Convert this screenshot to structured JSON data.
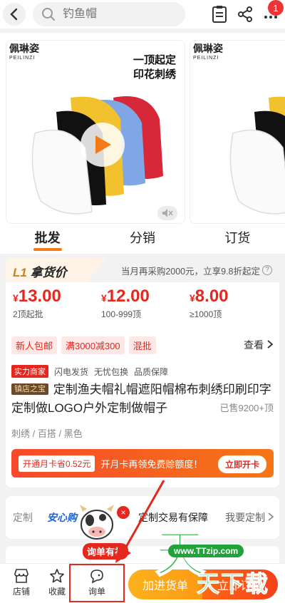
{
  "search": {
    "placeholder": "钓鱼帽"
  },
  "header": {
    "notification_count": "1"
  },
  "carousel": {
    "brand_cn": "佩琳姿",
    "brand_en": "PEILINZI",
    "promo_line1": "一顶起定",
    "promo_line2": "印花刺绣",
    "second_brand_cn": "佩琳姿",
    "second_brand_en": "PEILINZI"
  },
  "tabs": [
    {
      "label": "批发",
      "active": true
    },
    {
      "label": "分销",
      "active": false
    },
    {
      "label": "订货",
      "active": false
    }
  ],
  "tier": {
    "level": "L1",
    "level_label": "拿货价",
    "promo": "当月再采购2000元，立享9.8折起定",
    "help": "?"
  },
  "prices": [
    {
      "currency": "¥",
      "amount": "13.00",
      "range": "2顶起批"
    },
    {
      "currency": "¥",
      "amount": "12.00",
      "range": "100-999顶"
    },
    {
      "currency": "¥",
      "amount": "8.00",
      "range": "≥1000顶"
    }
  ],
  "tags": [
    "新人包邮",
    "满3000减300",
    "混批"
  ],
  "view_more": "查看",
  "service_badges": {
    "merchant": "实力商家",
    "items": [
      "闪电发货",
      "无忧包换",
      "品质保障"
    ]
  },
  "product": {
    "store_badge": "镇店之宝",
    "title": "定制渔夫帽礼帽遮阳帽棉布刺绣印刷印字定制做LOGO户外定制做帽子",
    "sold": "已售9200+顶",
    "attrs": "刺绣 / 百搭 / 黑色"
  },
  "member": {
    "chip": "开通月卡省0.52元",
    "text": "开月卡再领免费赊额度！",
    "button": "立即开卡"
  },
  "customize": {
    "label": "定制",
    "logo": "安心购",
    "guarantee": "定制交易有保障",
    "link": "我要定制"
  },
  "mascot": {
    "bubble": "询单有礼",
    "close": "×"
  },
  "bottom": {
    "shop": "店铺",
    "favorite": "收藏",
    "inquiry": "询单",
    "add_cart": "加进货单",
    "buy_now": "立即订购"
  },
  "watermark": {
    "url": "www.TTzip.com",
    "main": "天",
    "sub": "天下载"
  },
  "colors": {
    "accent": "#f47a18",
    "price_red": "#e5281e",
    "cart_orange": "#fca218",
    "buy_red": "#f4401d"
  }
}
